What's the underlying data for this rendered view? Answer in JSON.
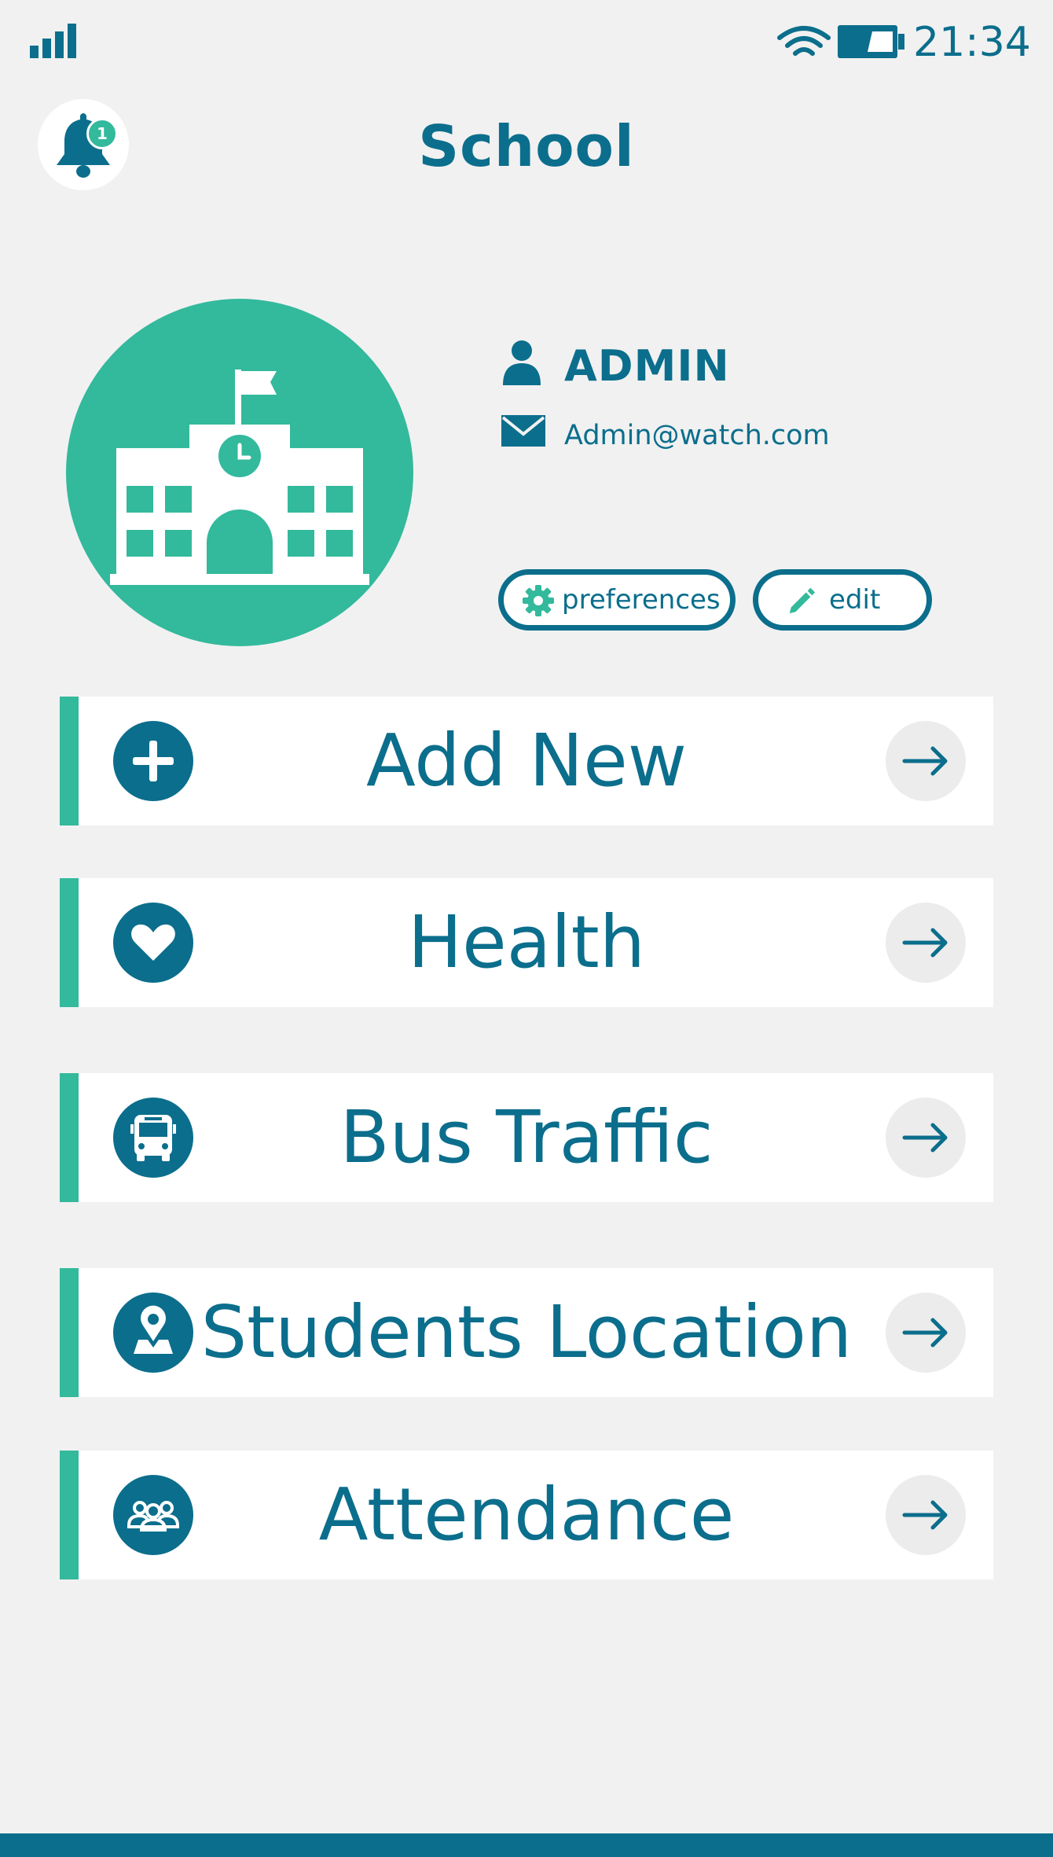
{
  "status_bar": {
    "time": "21:34"
  },
  "header": {
    "title": "School",
    "notification_count": "1"
  },
  "profile": {
    "name": "ADMIN",
    "email": "Admin@watch.com",
    "preferences_label": "preferences",
    "edit_label": "edit"
  },
  "menu": [
    {
      "label": "Add New",
      "icon": "plus-icon"
    },
    {
      "label": "Health",
      "icon": "heart-icon"
    },
    {
      "label": "Bus Traffic",
      "icon": "bus-icon"
    },
    {
      "label": "Students Location",
      "icon": "location-pin-icon"
    },
    {
      "label": "Attendance",
      "icon": "group-icon"
    }
  ],
  "colors": {
    "primary": "#0b6e8c",
    "accent": "#33b99c",
    "background": "#f1f1f1",
    "card": "#ffffff"
  }
}
